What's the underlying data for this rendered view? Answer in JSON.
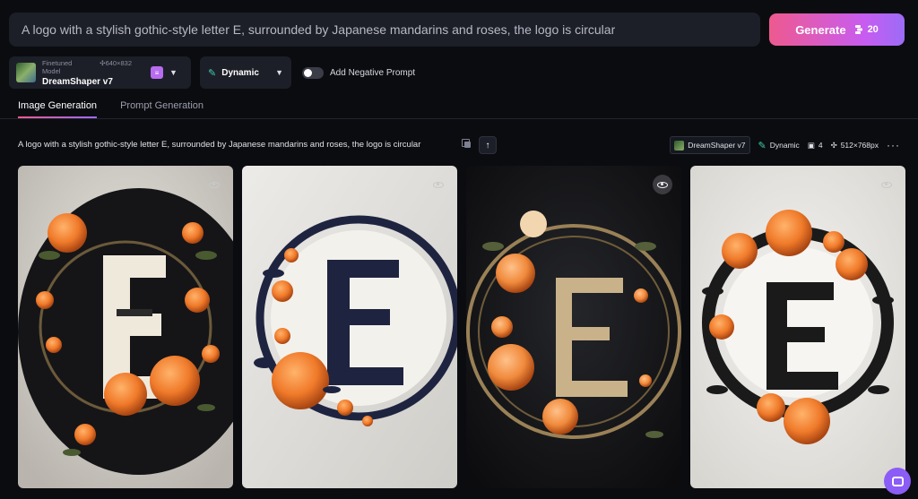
{
  "prompt": {
    "text": "A logo with a stylish gothic-style letter E, surrounded by Japanese mandarins and roses, the logo is circular"
  },
  "generate": {
    "label": "Generate",
    "tokens": "20"
  },
  "model": {
    "kicker": "Finetuned Model",
    "dimensions": "640×832",
    "name": "DreamShaper v7"
  },
  "style": {
    "label": "Dynamic"
  },
  "negative_prompt": {
    "label": "Add Negative Prompt",
    "enabled": false
  },
  "tabs": [
    {
      "label": "Image Generation",
      "active": true
    },
    {
      "label": "Prompt Generation",
      "active": false
    }
  ],
  "generation": {
    "prompt": "A logo with a stylish gothic-style letter E, surrounded by Japanese mandarins and roses, the logo is circular",
    "model": "DreamShaper v7",
    "style": "Dynamic",
    "count": "4",
    "size": "512×768px"
  },
  "colors": {
    "accent_start": "#ee5a8f",
    "accent_end": "#9b6cf6",
    "background": "#0b0c10",
    "panel": "#1d1f28",
    "orange": "#f08a3c"
  },
  "cards": [
    {
      "theme": "beige-bg-black-disc",
      "eye_style": "light"
    },
    {
      "theme": "cream-bg-navy-e",
      "eye_style": "light"
    },
    {
      "theme": "black-bg-gold-ring",
      "eye_style": "dark"
    },
    {
      "theme": "cream-bg-dark-wreath",
      "eye_style": "light"
    }
  ]
}
